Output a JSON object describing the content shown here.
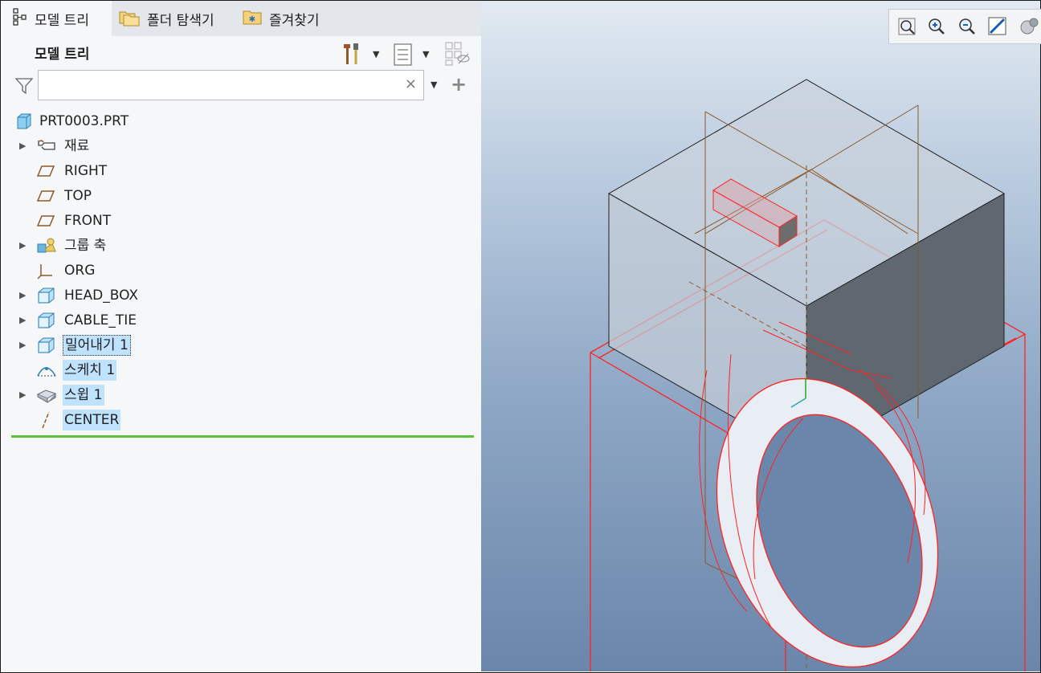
{
  "tabs": [
    {
      "label": "모델 트리",
      "icon": "model-tree-icon",
      "active": true
    },
    {
      "label": "폴더 탐색기",
      "icon": "folder-browser-icon",
      "active": false
    },
    {
      "label": "즐겨찾기",
      "icon": "favorites-icon",
      "active": false
    }
  ],
  "panel": {
    "title": "모델 트리"
  },
  "search": {
    "value": "",
    "placeholder": ""
  },
  "tree": {
    "root": "PRT0003.PRT",
    "items": [
      {
        "label": "재료",
        "icon": "material-icon",
        "expandable": true,
        "selected": false
      },
      {
        "label": "RIGHT",
        "icon": "datum-plane-icon",
        "expandable": false,
        "selected": false
      },
      {
        "label": "TOP",
        "icon": "datum-plane-icon",
        "expandable": false,
        "selected": false
      },
      {
        "label": "FRONT",
        "icon": "datum-plane-icon",
        "expandable": false,
        "selected": false
      },
      {
        "label": "그룹 축",
        "icon": "group-icon",
        "expandable": true,
        "selected": false
      },
      {
        "label": "ORG",
        "icon": "coordinate-system-icon",
        "expandable": false,
        "selected": false
      },
      {
        "label": "HEAD_BOX",
        "icon": "solid-feature-icon",
        "expandable": true,
        "selected": false
      },
      {
        "label": "CABLE_TIE",
        "icon": "solid-feature-icon",
        "expandable": true,
        "selected": false
      },
      {
        "label": "밀어내기 1",
        "icon": "solid-feature-icon",
        "expandable": true,
        "selected": true
      },
      {
        "label": "스케치 1",
        "icon": "sketch-icon",
        "expandable": false,
        "selected": true
      },
      {
        "label": "스윕 1",
        "icon": "sweep-icon",
        "expandable": true,
        "selected": true
      },
      {
        "label": "CENTER",
        "icon": "datum-axis-icon",
        "expandable": false,
        "selected": true
      }
    ]
  },
  "colors": {
    "selection": "#bfe2ff",
    "insert_line": "#5cc23a",
    "datum_brown": "#8b5a2b",
    "edge_red": "#ff2020"
  }
}
